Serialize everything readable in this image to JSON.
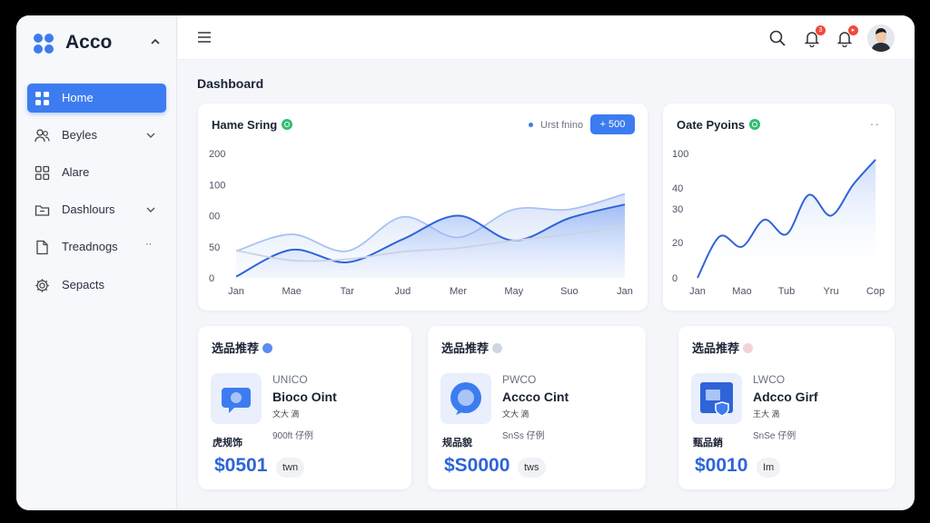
{
  "app": {
    "name": "Acco"
  },
  "sidebar": {
    "items": [
      {
        "label": "Home",
        "icon": "grid-icon",
        "active": true
      },
      {
        "label": "Beyles",
        "icon": "users-icon",
        "caret": true
      },
      {
        "label": "Alare",
        "icon": "apps-icon"
      },
      {
        "label": "Dashlours",
        "icon": "folder-icon",
        "caret": true
      },
      {
        "label": "Treadnogs",
        "icon": "document-icon",
        "more": "··"
      },
      {
        "label": "Sepacts",
        "icon": "gear-icon"
      }
    ]
  },
  "topbar": {
    "notifications": [
      {
        "icon": "bell-icon",
        "badge": "3"
      },
      {
        "icon": "alert-bell-icon",
        "badge": "▸"
      }
    ]
  },
  "page": {
    "title": "Dashboard"
  },
  "cards": {
    "home": {
      "title": "Hame Sring",
      "legend": "Urst fnino",
      "button": "+ 500"
    },
    "ote": {
      "title": "Oate Pyoins",
      "more": "··"
    }
  },
  "chart_data": [
    {
      "type": "area",
      "title": "Hame Sring",
      "x": [
        "Jan",
        "Mae",
        "Tar",
        "Jud",
        "Mer",
        "May",
        "Suo",
        "Jan"
      ],
      "y_ticks": [
        "200",
        "100",
        "00",
        "50",
        "0"
      ],
      "ylim": [
        0,
        200
      ],
      "series": [
        {
          "values": [
            2,
            45,
            25,
            62,
            100,
            60,
            96,
            118
          ],
          "color": "#2e64d8",
          "fill": true
        },
        {
          "values": [
            43,
            70,
            43,
            98,
            65,
            110,
            110,
            135
          ],
          "color": "#a8c2f2",
          "fill": true
        },
        {
          "values": [
            44,
            28,
            30,
            42,
            48,
            60,
            70,
            82
          ],
          "color": "#c9d3e2",
          "fill": false
        }
      ],
      "legend": "top-right",
      "grid": false
    },
    {
      "type": "line",
      "title": "Oate Pyoins",
      "x": [
        "Jan",
        "Mao",
        "Tub",
        "Yru",
        "Cop"
      ],
      "y_ticks": [
        "100",
        "40",
        "30",
        "20",
        "0"
      ],
      "values": [
        0,
        20,
        15,
        28,
        21,
        40,
        30,
        45,
        57
      ],
      "ylim": [
        0,
        60
      ],
      "color": "#2e64d8",
      "grid": false
    }
  ],
  "recommendations": [
    {
      "title": "选品推荐",
      "dot": "#5b8def",
      "brand": "UNICO",
      "name": "Bioco Oint",
      "stars": "文大 滴",
      "meta": "900ft 仔例",
      "label": "虎规饰",
      "price": "$0501",
      "unit": "twn",
      "icon_color": "#3d7cf0"
    },
    {
      "title": "选品推荐",
      "dot": "#cfd6de",
      "brand": "PWCO",
      "name": "Accco Cint",
      "stars": "文大 滴",
      "meta": "SnSs 仔例",
      "label": "规品貌",
      "price": "$S0000",
      "unit": "tws",
      "icon_color": "#3d7cf0"
    },
    {
      "title": "选品推荐",
      "dot": "#f3d2d6",
      "brand": "LWCO",
      "name": "Adcco Girf",
      "stars": "王大 滴",
      "meta": "SnSe 仔例",
      "label": "甄品銷",
      "price": "$0010",
      "unit": "Im",
      "icon_color": "#3d7cf0"
    }
  ]
}
